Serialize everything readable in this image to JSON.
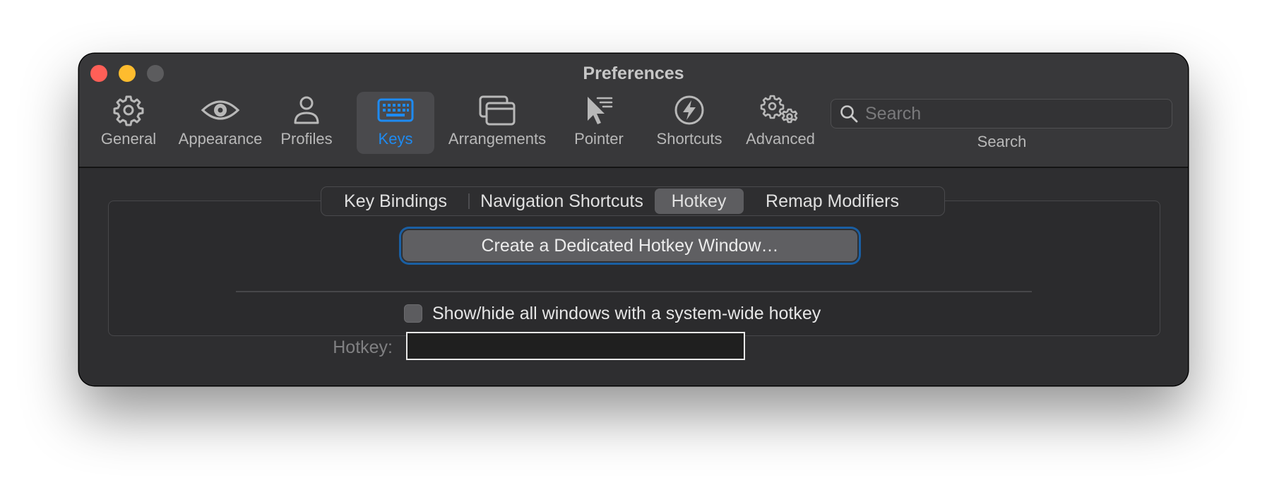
{
  "window": {
    "title": "Preferences"
  },
  "toolbar": {
    "items": [
      {
        "label": "General",
        "icon": "gear-icon"
      },
      {
        "label": "Appearance",
        "icon": "eye-icon"
      },
      {
        "label": "Profiles",
        "icon": "person-icon"
      },
      {
        "label": "Keys",
        "icon": "keyboard-icon",
        "selected": true
      },
      {
        "label": "Arrangements",
        "icon": "windows-icon"
      },
      {
        "label": "Pointer",
        "icon": "pointer-icon"
      },
      {
        "label": "Shortcuts",
        "icon": "bolt-icon"
      },
      {
        "label": "Advanced",
        "icon": "gears-icon"
      }
    ],
    "search": {
      "placeholder": "Search",
      "value": "",
      "caption": "Search"
    },
    "accent_color": "#1e8bf2"
  },
  "keys_pane": {
    "tabs": [
      {
        "label": "Key Bindings"
      },
      {
        "label": "Navigation Shortcuts"
      },
      {
        "label": "Hotkey",
        "selected": true
      },
      {
        "label": "Remap Modifiers"
      }
    ],
    "create_button_label": "Create a Dedicated Hotkey Window…",
    "show_hide_label": "Show/hide all windows with a system-wide hotkey",
    "show_hide_checked": false,
    "hotkey_label": "Hotkey:",
    "hotkey_value": ""
  }
}
